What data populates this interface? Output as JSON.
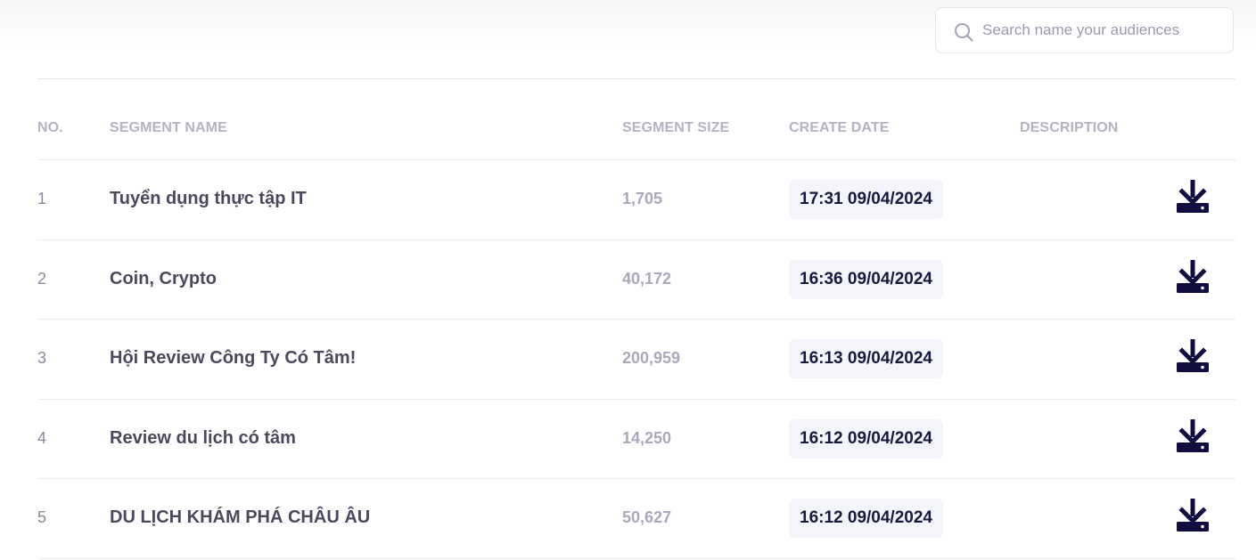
{
  "search": {
    "placeholder": "Search name your audiences",
    "value": ""
  },
  "table": {
    "headers": {
      "no": "NO.",
      "name": "SEGMENT NAME",
      "size": "SEGMENT SIZE",
      "date": "CREATE DATE",
      "description": "DESCRIPTION"
    },
    "rows": [
      {
        "no": "1",
        "name": "Tuyển dụng thực tập IT",
        "size": "1,705",
        "date": "17:31 09/04/2024",
        "action_icon": "download-icon"
      },
      {
        "no": "2",
        "name": "Coin, Crypto",
        "size": "40,172",
        "date": "16:36 09/04/2024",
        "action_icon": "download-icon"
      },
      {
        "no": "3",
        "name": "Hội Review Công Ty Có Tâm!",
        "size": "200,959",
        "date": "16:13 09/04/2024",
        "action_icon": "download-icon"
      },
      {
        "no": "4",
        "name": "Review du lịch có tâm",
        "size": "14,250",
        "date": "16:12 09/04/2024",
        "action_icon": "download-icon"
      },
      {
        "no": "5",
        "name": "DU LỊCH KHÁM PHÁ CHÂU ÂU",
        "size": "50,627",
        "date": "16:12 09/04/2024",
        "action_icon": "download-icon"
      }
    ]
  },
  "colors": {
    "icon_dark": "#120d3f",
    "date_badge_bg": "#f4f4fb",
    "header_text": "#b3b3c4"
  }
}
